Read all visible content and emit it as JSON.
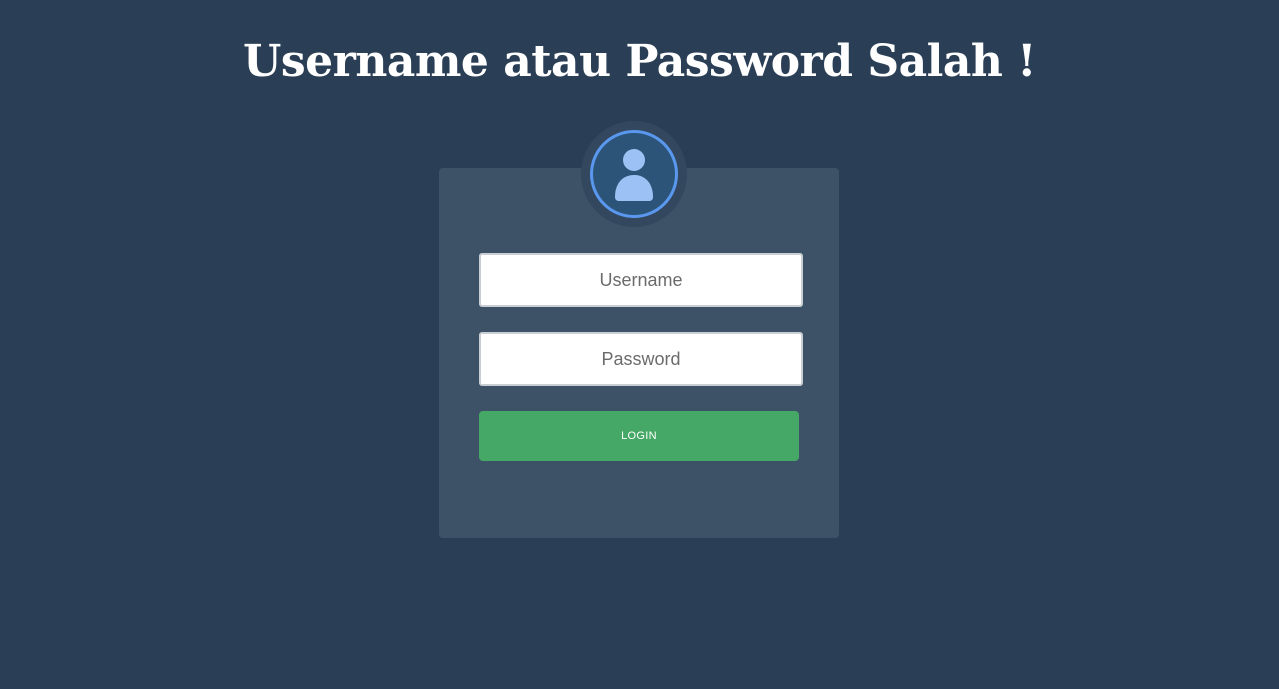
{
  "page": {
    "title": "Username atau Password Salah !"
  },
  "login_form": {
    "avatar_icon": "user-icon",
    "username": {
      "placeholder": "Username",
      "value": ""
    },
    "password": {
      "placeholder": "Password",
      "value": ""
    },
    "submit_label": "LOGIN"
  },
  "colors": {
    "background": "#2a3f55",
    "card": "#3d5267",
    "avatar_ring_accent": "#5a98f0",
    "avatar_fill": "#2b5478",
    "user_glyph": "#9cc2f5",
    "login_button": "#46a866",
    "title_text": "#ffffff"
  }
}
